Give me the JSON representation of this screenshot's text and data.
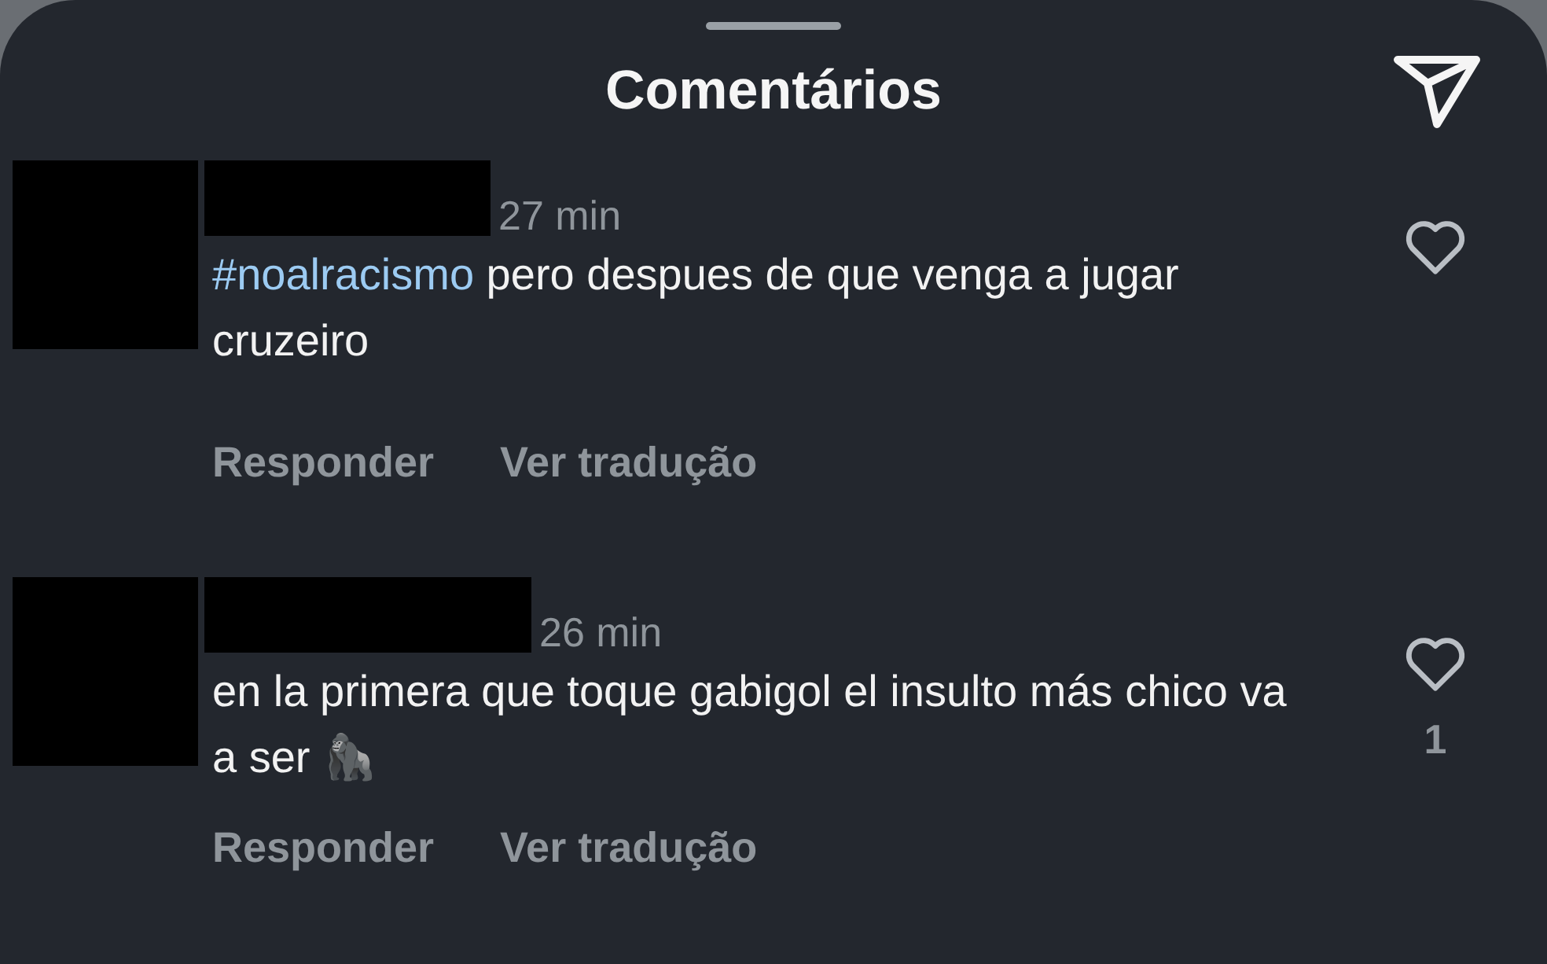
{
  "header": {
    "title": "Comentários"
  },
  "comments": [
    {
      "time": "27 min",
      "hashtag": "#noalracismo",
      "text": " pero despues de que venga a jugar cruzeiro",
      "liked": false,
      "actions": [
        "Responder",
        "Ver tradução"
      ]
    },
    {
      "time": "26 min",
      "text": "en la primera que toque gabigol el insulto más chico va a ser 🦍",
      "liked": false,
      "like_count": "1",
      "actions": [
        "Responder",
        "Ver tradução"
      ]
    }
  ]
}
